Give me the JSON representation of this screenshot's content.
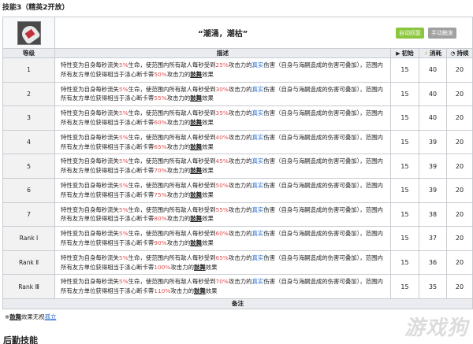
{
  "title": "技能3（精英2开放）",
  "skill": {
    "name": "“潮涌，潮枯”",
    "badges": [
      "自动回复",
      "手动触发"
    ]
  },
  "columns": {
    "level": "等级",
    "desc": "描述",
    "initial": "初始",
    "cost": "消耗",
    "duration": "持续"
  },
  "rows": [
    {
      "level": "1",
      "seg1": "特性变为自身每秒流失",
      "pct1": "5%",
      "seg2": "生命，使范围内所有敌人每秒受到",
      "pct2": "25%",
      "seg3": "攻击力的",
      "real": "真实",
      "seg4": "伤害（自身与海嗣造成的伤害可叠加），范围内所有友方单位获得相当于涤心断卡蒂",
      "pct3": "50%",
      "seg5": "攻击力的",
      "boost": "鼓舞",
      "seg6": "效果",
      "initial": "15",
      "cost": "40",
      "duration": "20"
    },
    {
      "level": "2",
      "seg1": "特性变为自身每秒流失",
      "pct1": "5%",
      "seg2": "生命，使范围内所有敌人每秒受到",
      "pct2": "30%",
      "seg3": "攻击力的",
      "real": "真实",
      "seg4": "伤害（自身与海嗣造成的伤害可叠加），范围内所有友方单位获得相当于涤心断卡蒂",
      "pct3": "55%",
      "seg5": "攻击力的",
      "boost": "鼓舞",
      "seg6": "效果",
      "initial": "15",
      "cost": "40",
      "duration": "20"
    },
    {
      "level": "3",
      "seg1": "特性变为自身每秒流失",
      "pct1": "5%",
      "seg2": "生命，使范围内所有敌人每秒受到",
      "pct2": "35%",
      "seg3": "攻击力的",
      "real": "真实",
      "seg4": "伤害（自身与海嗣造成的伤害可叠加），范围内所有友方单位获得相当于涤心断卡蒂",
      "pct3": "60%",
      "seg5": "攻击力的",
      "boost": "鼓舞",
      "seg6": "效果",
      "initial": "15",
      "cost": "40",
      "duration": "20"
    },
    {
      "level": "4",
      "seg1": "特性变为自身每秒流失",
      "pct1": "5%",
      "seg2": "生命，使范围内所有敌人每秒受到",
      "pct2": "40%",
      "seg3": "攻击力的",
      "real": "真实",
      "seg4": "伤害（自身与海嗣造成的伤害可叠加），范围内所有友方单位获得相当于涤心断卡蒂",
      "pct3": "65%",
      "seg5": "攻击力的",
      "boost": "鼓舞",
      "seg6": "效果",
      "initial": "15",
      "cost": "39",
      "duration": "20"
    },
    {
      "level": "5",
      "seg1": "特性变为自身每秒流失",
      "pct1": "5%",
      "seg2": "生命，使范围内所有敌人每秒受到",
      "pct2": "45%",
      "seg3": "攻击力的",
      "real": "真实",
      "seg4": "伤害（自身与海嗣造成的伤害可叠加），范围内所有友方单位获得相当于涤心断卡蒂",
      "pct3": "70%",
      "seg5": "攻击力的",
      "boost": "鼓舞",
      "seg6": "效果",
      "initial": "15",
      "cost": "39",
      "duration": "20"
    },
    {
      "level": "6",
      "seg1": "特性变为自身每秒流失",
      "pct1": "5%",
      "seg2": "生命，使范围内所有敌人每秒受到",
      "pct2": "50%",
      "seg3": "攻击力的",
      "real": "真实",
      "seg4": "伤害（自身与海嗣造成的伤害可叠加），范围内所有友方单位获得相当于涤心断卡蒂",
      "pct3": "75%",
      "seg5": "攻击力的",
      "boost": "鼓舞",
      "seg6": "效果",
      "initial": "15",
      "cost": "39",
      "duration": "20"
    },
    {
      "level": "7",
      "seg1": "特性变为自身每秒流失",
      "pct1": "5%",
      "seg2": "生命，使范围内所有敌人每秒受到",
      "pct2": "55%",
      "seg3": "攻击力的",
      "real": "真实",
      "seg4": "伤害（自身与海嗣造成的伤害可叠加），范围内所有友方单位获得相当于涤心断卡蒂",
      "pct3": "80%",
      "seg5": "攻击力的",
      "boost": "鼓舞",
      "seg6": "效果",
      "initial": "15",
      "cost": "38",
      "duration": "20"
    },
    {
      "level": "Rank Ⅰ",
      "seg1": "特性变为自身每秒流失",
      "pct1": "5%",
      "seg2": "生命，使范围内所有敌人每秒受到",
      "pct2": "60%",
      "seg3": "攻击力的",
      "real": "真实",
      "seg4": "伤害（自身与海嗣造成的伤害可叠加），范围内所有友方单位获得相当于涤心断卡蒂",
      "pct3": "90%",
      "seg5": "攻击力的",
      "boost": "鼓舞",
      "seg6": "效果",
      "initial": "15",
      "cost": "37",
      "duration": "20"
    },
    {
      "level": "Rank Ⅱ",
      "seg1": "特性变为自身每秒流失",
      "pct1": "5%",
      "seg2": "生命，使范围内所有敌人每秒受到",
      "pct2": "65%",
      "seg3": "攻击力的",
      "real": "真实",
      "seg4": "伤害（自身与海嗣造成的伤害可叠加），范围内所有友方单位获得相当于涤心断卡蒂",
      "pct3": "100%",
      "seg5": "攻击力的",
      "boost": "鼓舞",
      "seg6": "效果",
      "initial": "15",
      "cost": "36",
      "duration": "20"
    },
    {
      "level": "Rank Ⅲ",
      "seg1": "特性变为自身每秒流失",
      "pct1": "5%",
      "seg2": "生命，使范围内所有敌人每秒受到",
      "pct2": "70%",
      "seg3": "攻击力的",
      "real": "真实",
      "seg4": "伤害（自身与海嗣造成的伤害可叠加），范围内所有友方单位获得相当于涤心断卡蒂",
      "pct3": "110%",
      "seg5": "攻击力的",
      "boost": "鼓舞",
      "seg6": "效果",
      "initial": "15",
      "cost": "35",
      "duration": "20"
    }
  ],
  "note_header": "备注",
  "footnote": {
    "prefix": "※",
    "boost": "鼓舞",
    "middle": "效果无视",
    "link": "孤立"
  },
  "next_section": "后勤技能",
  "watermark": "游戏狗",
  "colors": {
    "percent": "#e05050",
    "link": "#2a6fd0",
    "auto_badge": "#8cc63e",
    "manual_badge": "#a0a0a0"
  }
}
